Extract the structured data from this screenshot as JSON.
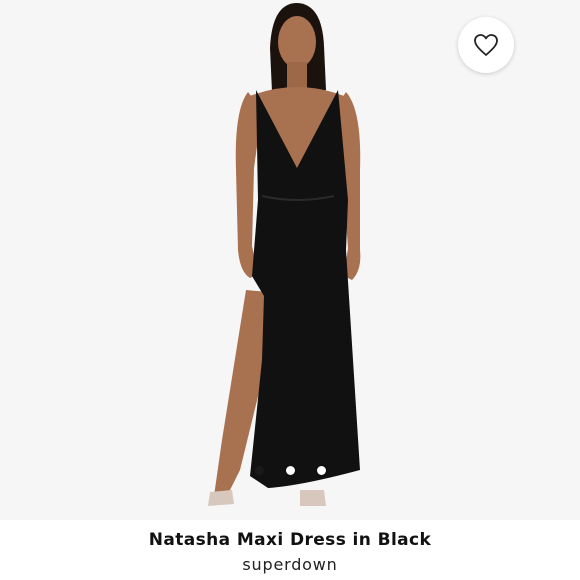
{
  "product": {
    "title": "Natasha Maxi Dress in Black",
    "brand": "superdown",
    "image_alt": "Model wearing black plunging maxi dress with side slit"
  },
  "gallery": {
    "slide_count": 3,
    "active_index": 0
  },
  "favorite": {
    "icon": "heart-outline-icon",
    "active": false
  },
  "colors": {
    "background": "#f6f6f6",
    "dress": "#111111",
    "skin": "#a8714f"
  }
}
